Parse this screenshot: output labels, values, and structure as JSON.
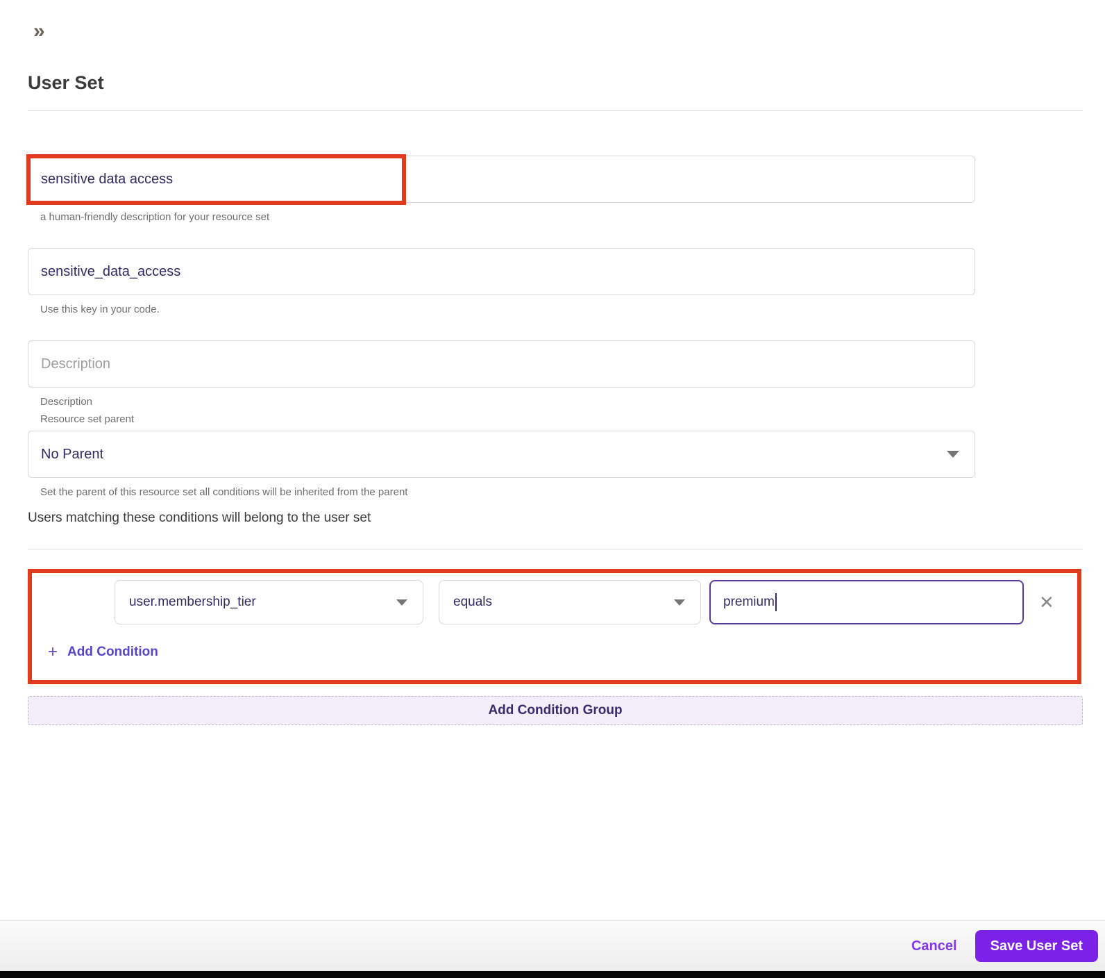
{
  "header": {
    "collapse_icon": "»",
    "title": "User Set"
  },
  "form": {
    "name_field": {
      "value": "sensitive data access",
      "helper": "a human-friendly description for your resource set"
    },
    "key_field": {
      "value": "sensitive_data_access",
      "helper": "Use this key in your code."
    },
    "description_field": {
      "placeholder": "Description",
      "helper": "Description"
    },
    "parent_field": {
      "label": "Resource set parent",
      "value": "No Parent",
      "helper": "Set the parent of this resource set all conditions will be inherited from the parent"
    },
    "conditions_intro": "Users matching these conditions will belong to the user set"
  },
  "condition_group": {
    "condition": {
      "attribute": "user.membership_tier",
      "operator": "equals",
      "value": "premium"
    },
    "remove_icon": "✕",
    "add_condition_icon": "+",
    "add_condition_label": "Add Condition",
    "add_group_label": "Add Condition Group"
  },
  "footer": {
    "cancel_label": "Cancel",
    "save_label": "Save User Set"
  },
  "colors": {
    "annotation_red": "#e23a1c",
    "primary_purple": "#7c22e8",
    "accent_link": "#5746c8",
    "input_text": "#2f2a63"
  }
}
